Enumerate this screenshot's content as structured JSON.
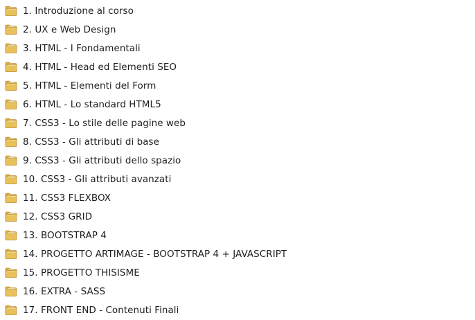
{
  "explorer": {
    "items": [
      {
        "label": "1. Introduzione al corso",
        "icon": "folder-icon"
      },
      {
        "label": "2. UX e Web Design",
        "icon": "folder-icon"
      },
      {
        "label": "3. HTML - I Fondamentali",
        "icon": "folder-icon"
      },
      {
        "label": "4. HTML - Head ed Elementi SEO",
        "icon": "folder-icon"
      },
      {
        "label": "5. HTML - Elementi del Form",
        "icon": "folder-icon"
      },
      {
        "label": "6. HTML - Lo standard HTML5",
        "icon": "folder-icon"
      },
      {
        "label": "7. CSS3 - Lo stile delle pagine web",
        "icon": "folder-icon"
      },
      {
        "label": "8. CSS3 - Gli attributi di base",
        "icon": "folder-icon"
      },
      {
        "label": "9. CSS3 - Gli attributi dello spazio",
        "icon": "folder-icon"
      },
      {
        "label": "10. CSS3 - Gli attributi avanzati",
        "icon": "folder-icon"
      },
      {
        "label": "11. CSS3 FLEXBOX",
        "icon": "folder-icon"
      },
      {
        "label": "12. CSS3 GRID",
        "icon": "folder-icon"
      },
      {
        "label": "13. BOOTSTRAP 4",
        "icon": "folder-icon"
      },
      {
        "label": "14. PROGETTO ARTIMAGE - BOOTSTRAP 4 + JAVASCRIPT",
        "icon": "folder-icon"
      },
      {
        "label": "15. PROGETTO THISISME",
        "icon": "folder-icon"
      },
      {
        "label": "16. EXTRA - SASS",
        "icon": "folder-icon"
      },
      {
        "label": "17. FRONT END - Contenuti Finali",
        "icon": "folder-icon"
      }
    ]
  },
  "colors": {
    "folder_body": "#e8c15a",
    "folder_back": "#d9a93a",
    "folder_paper": "#fbf3d6",
    "text": "#1e1e1e",
    "background": "#ffffff"
  }
}
